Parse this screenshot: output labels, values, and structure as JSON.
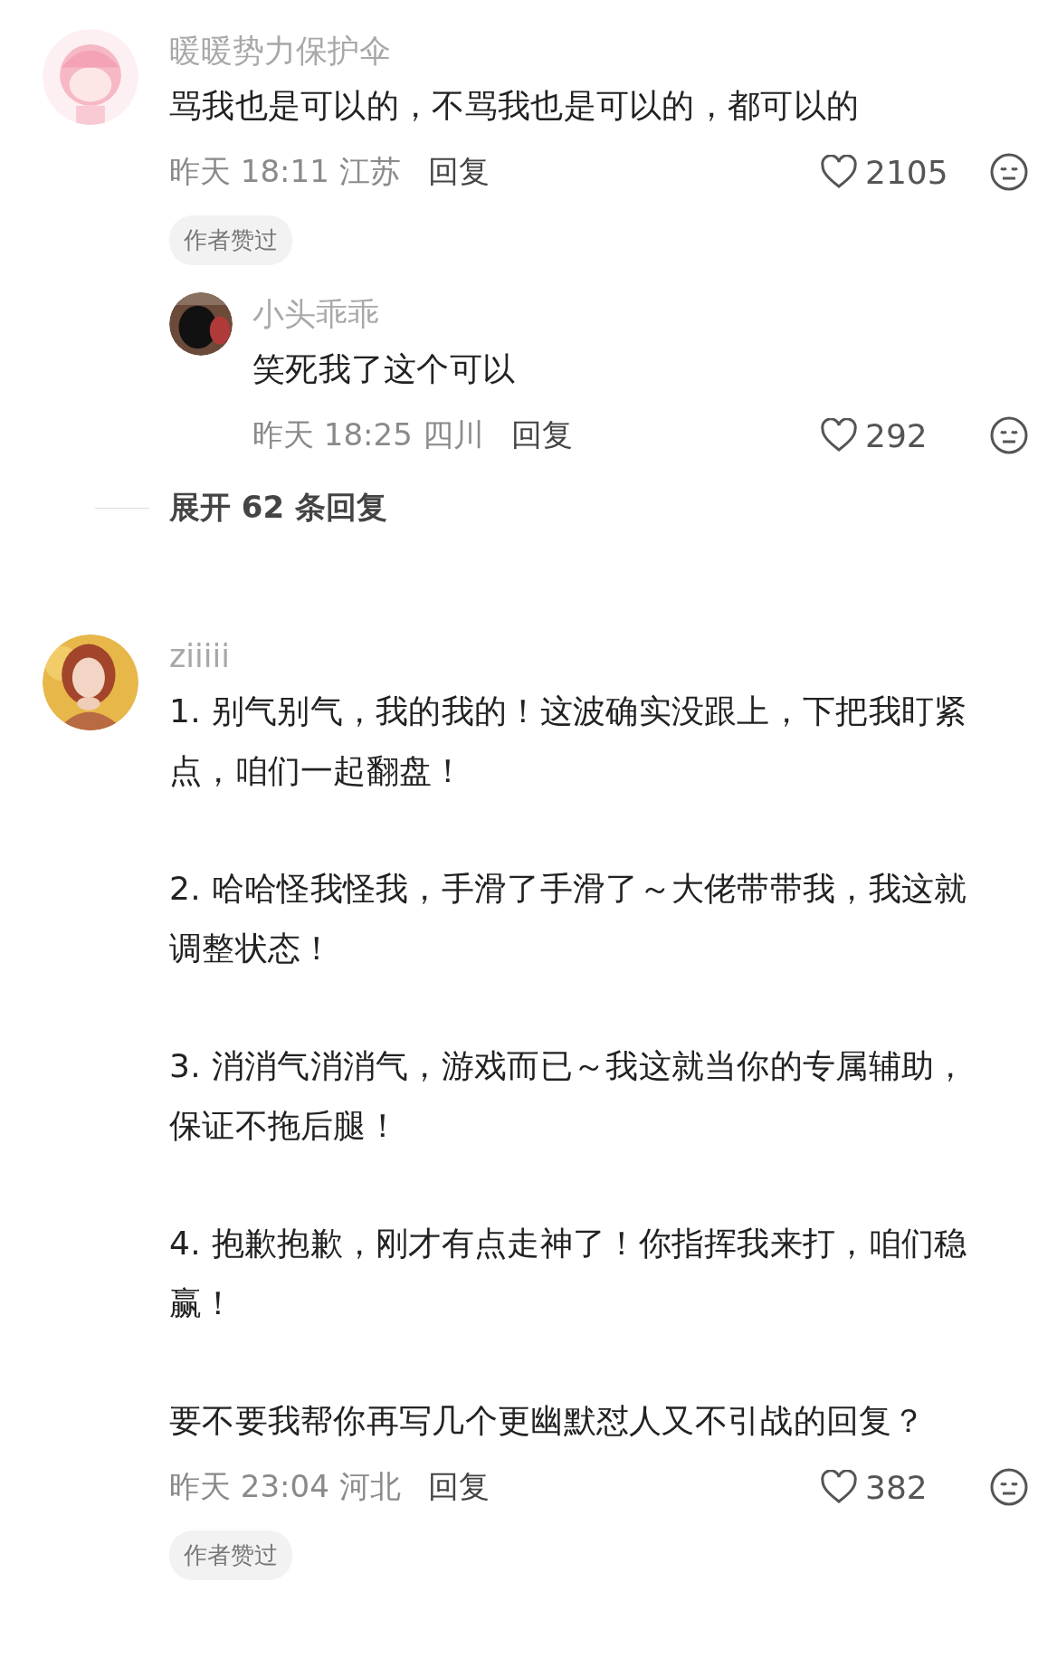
{
  "comments": [
    {
      "author": "暖暖势力保护伞",
      "avatar": {
        "kind": "picture"
      },
      "paragraphs": [
        "骂我也是可以的，不骂我也是可以的，都可以的"
      ],
      "time": "昨天 18:11 江苏",
      "reply_label": "回复",
      "likes": "2105",
      "badge": "作者赞过",
      "replies": [
        {
          "author": "小头乖乖",
          "avatar": {
            "kind": "picture"
          },
          "paragraphs": [
            "笑死我了这个可以"
          ],
          "time": "昨天 18:25 四川",
          "reply_label": "回复",
          "likes": "292"
        }
      ],
      "expand": "展开 62 条回复"
    },
    {
      "author": "ziiiii",
      "avatar": {
        "kind": "picture"
      },
      "paragraphs": [
        "1. 别气别气，我的我的！这波确实没跟上，下把我盯紧点，咱们一起翻盘！",
        "2. 哈哈怪我怪我，手滑了手滑了～大佬带带我，我这就调整状态！",
        "3. 消消气消消气，游戏而已～我这就当你的专属辅助，保证不拖后腿！",
        "4. 抱歉抱歉，刚才有点走神了！你指挥我来打，咱们稳赢！",
        "要不要我帮你再写几个更幽默怼人又不引战的回复？"
      ],
      "time": "昨天 23:04 河北",
      "reply_label": "回复",
      "likes": "382",
      "badge": "作者赞过"
    }
  ]
}
